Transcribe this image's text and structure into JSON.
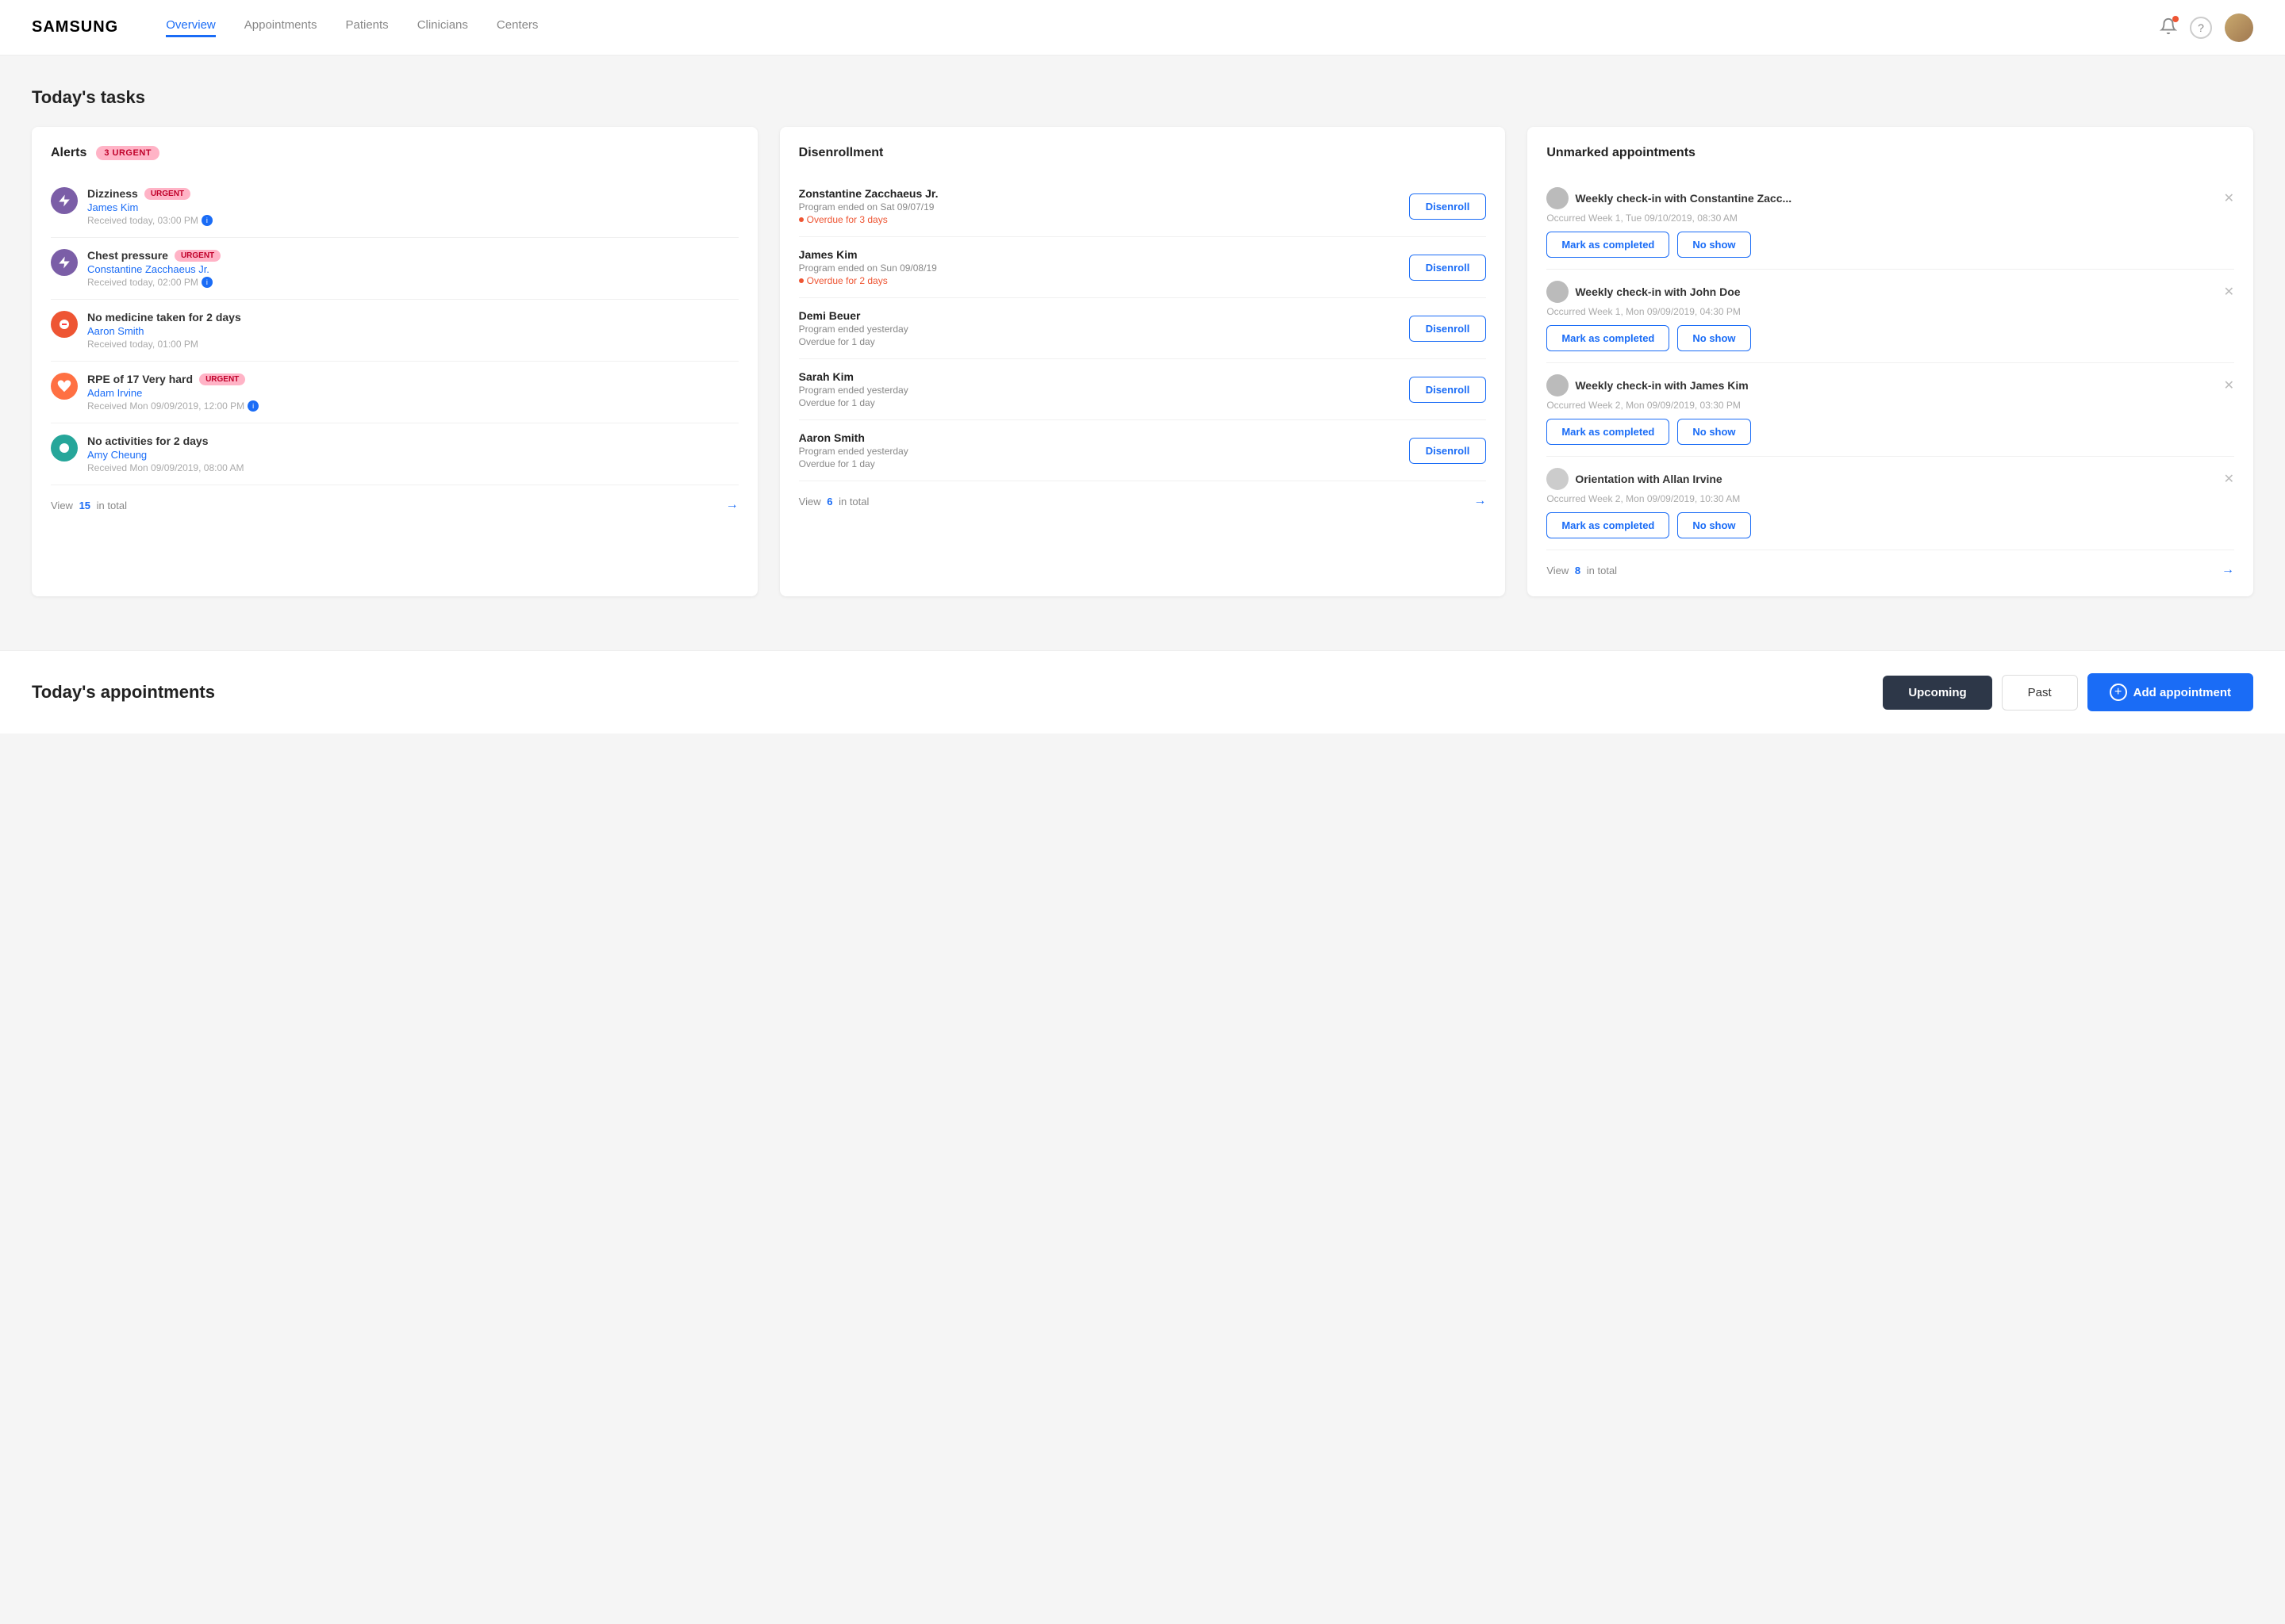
{
  "header": {
    "logo": "SAMSUNG",
    "nav": [
      {
        "label": "Overview",
        "active": true
      },
      {
        "label": "Appointments",
        "active": false
      },
      {
        "label": "Patients",
        "active": false
      },
      {
        "label": "Clinicians",
        "active": false
      },
      {
        "label": "Centers",
        "active": false
      }
    ]
  },
  "todaysTasks": {
    "title": "Today's tasks",
    "alerts": {
      "sectionTitle": "Alerts",
      "badge": "3 URGENT",
      "items": [
        {
          "icon": "⚡",
          "iconType": "purple",
          "title": "Dizziness",
          "urgent": true,
          "patient": "James Kim",
          "time": "Received today, 03:00 PM"
        },
        {
          "icon": "⚡",
          "iconType": "purple",
          "title": "Chest pressure",
          "urgent": true,
          "patient": "Constantine Zacchaeus Jr.",
          "time": "Received today, 02:00 PM"
        },
        {
          "icon": "💊",
          "iconType": "red",
          "title": "No medicine taken for 2 days",
          "urgent": false,
          "patient": "Aaron Smith",
          "time": "Received today, 01:00 PM"
        },
        {
          "icon": "❤",
          "iconType": "orange",
          "title": "RPE of 17 Very hard",
          "urgent": true,
          "patient": "Adam Irvine",
          "time": "Received Mon 09/09/2019, 12:00 PM"
        },
        {
          "icon": "🏃",
          "iconType": "teal",
          "title": "No activities for 2 days",
          "urgent": false,
          "patient": "Amy Cheung",
          "time": "Received Mon 09/09/2019, 08:00 AM"
        }
      ],
      "viewText": "View",
      "viewCount": "15",
      "viewSuffix": "in total"
    },
    "disenrollment": {
      "sectionTitle": "Disenrollment",
      "items": [
        {
          "name": "Zonstantine Zacchaeus Jr.",
          "date": "Program ended on Sat 09/07/19",
          "overdue": "Overdue for 3 days",
          "showDot": true
        },
        {
          "name": "James Kim",
          "date": "Program ended on Sun 09/08/19",
          "overdue": "Overdue for 2 days",
          "showDot": true
        },
        {
          "name": "Demi Beuer",
          "date": "Program ended yesterday",
          "overdue": "Overdue for 1 day",
          "showDot": false
        },
        {
          "name": "Sarah Kim",
          "date": "Program ended yesterday",
          "overdue": "Overdue for 1 day",
          "showDot": false
        },
        {
          "name": "Aaron Smith",
          "date": "Program ended yesterday",
          "overdue": "Overdue for 1 day",
          "showDot": false
        }
      ],
      "buttonLabel": "Disenroll",
      "viewText": "View",
      "viewCount": "6",
      "viewSuffix": "in total"
    },
    "unmarkedAppointments": {
      "sectionTitle": "Unmarked appointments",
      "items": [
        {
          "title": "Weekly check-in with Constantine Zacc...",
          "time": "Occurred Week 1, Tue 09/10/2019, 08:30 AM"
        },
        {
          "title": "Weekly check-in with John Doe",
          "time": "Occurred Week 1, Mon 09/09/2019, 04:30 PM"
        },
        {
          "title": "Weekly check-in with James Kim",
          "time": "Occurred Week 2, Mon 09/09/2019, 03:30 PM"
        },
        {
          "title": "Orientation with Allan Irvine",
          "time": "Occurred Week 2, Mon 09/09/2019, 10:30 AM"
        }
      ],
      "markLabel": "Mark as completed",
      "noShowLabel": "No show",
      "viewText": "View",
      "viewCount": "8",
      "viewSuffix": "in total"
    }
  },
  "todaysAppointments": {
    "title": "Today's appointments",
    "upcomingLabel": "Upcoming",
    "pastLabel": "Past",
    "addLabel": "Add appointment"
  }
}
